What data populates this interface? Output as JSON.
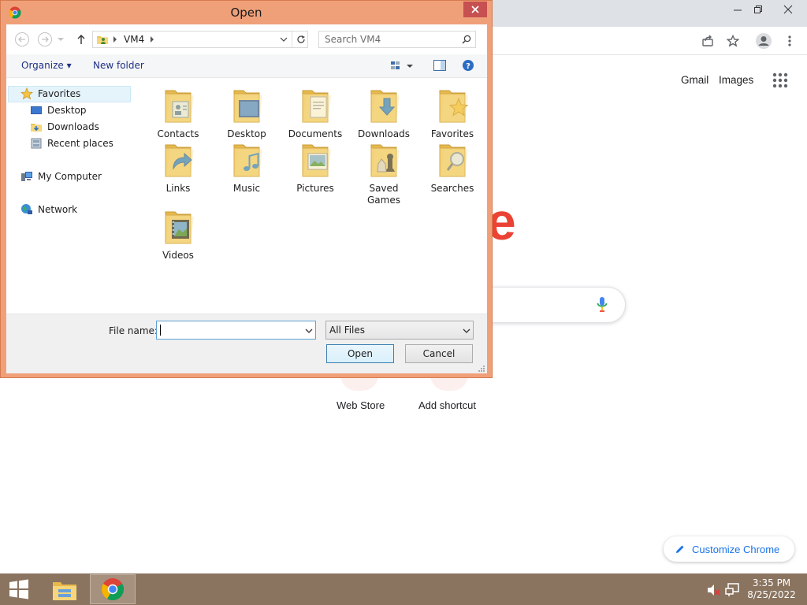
{
  "browser": {
    "top_links": [
      "Gmail",
      "Images"
    ],
    "shortcuts": [
      "Web Store",
      "Add shortcut"
    ],
    "customize_label": "Customize Chrome",
    "logo_fragment": "e"
  },
  "dialog": {
    "title": "Open",
    "address": {
      "path": [
        "VM4"
      ],
      "search_placeholder": "Search VM4"
    },
    "command_bar": {
      "organize": "Organize ▾",
      "new_folder": "New folder"
    },
    "nav_pane": {
      "favorites": "Favorites",
      "favorites_items": [
        "Desktop",
        "Downloads",
        "Recent places"
      ],
      "computer": "My Computer",
      "network": "Network"
    },
    "folders": [
      {
        "name": "Contacts",
        "icon": "contacts-folder-icon"
      },
      {
        "name": "Desktop",
        "icon": "desktop-folder-icon"
      },
      {
        "name": "Documents",
        "icon": "documents-folder-icon"
      },
      {
        "name": "Downloads",
        "icon": "downloads-folder-icon"
      },
      {
        "name": "Favorites",
        "icon": "favorites-folder-icon"
      },
      {
        "name": "Links",
        "icon": "links-folder-icon"
      },
      {
        "name": "Music",
        "icon": "music-folder-icon"
      },
      {
        "name": "Pictures",
        "icon": "pictures-folder-icon"
      },
      {
        "name": "Saved Games",
        "icon": "saved-games-folder-icon"
      },
      {
        "name": "Searches",
        "icon": "searches-folder-icon"
      },
      {
        "name": "Videos",
        "icon": "videos-folder-icon"
      }
    ],
    "file_name_label": "File name:",
    "file_name_value": "",
    "file_type": "All Files",
    "open_button": "Open",
    "cancel_button": "Cancel"
  },
  "taskbar": {
    "time": "3:35 PM",
    "date": "8/25/2022"
  },
  "colors": {
    "dialog_frame": "#f0a079",
    "taskbar": "#8a735f",
    "accent_blue": "#1a73e8",
    "close_red": "#c75050"
  }
}
